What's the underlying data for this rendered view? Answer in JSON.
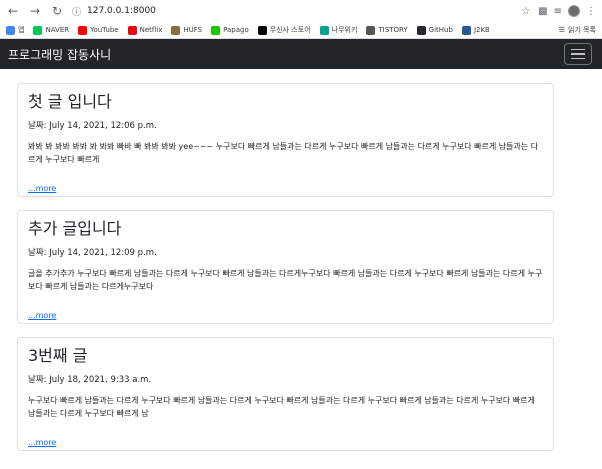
{
  "browser": {
    "url": "127.0.0.1:8000",
    "bookmarks": [
      {
        "label": "앱",
        "color": "#4285f4"
      },
      {
        "label": "NAVER",
        "color": "#03c75a"
      },
      {
        "label": "YouTube",
        "color": "#ff0000"
      },
      {
        "label": "Netflix",
        "color": "#e50914"
      },
      {
        "label": "HUFS",
        "color": "#8a6d3b"
      },
      {
        "label": "Papago",
        "color": "#1ec800"
      },
      {
        "label": "무신사 스토어",
        "color": "#000000"
      },
      {
        "label": "나무위키",
        "color": "#00a495"
      },
      {
        "label": "TISTORY",
        "color": "#555555"
      },
      {
        "label": "GitHub",
        "color": "#24292e"
      },
      {
        "label": "J2KB",
        "color": "#2b5797"
      }
    ],
    "reading_list": "읽기 목록"
  },
  "navbar": {
    "brand": "프로그래밍 잡동사니"
  },
  "posts": [
    {
      "title": "첫 글 입니다",
      "date": "날짜: July 14, 2021, 12:06 p.m.",
      "body": "봐봐 봐 봐봐 봐봐 봐 봐봐 빠바 빠 봐봐 봐봐 yee~~~ 누구보다 빠르게 남들과는 다르게 누구보다 빠르게 남들과는 다르게 누구보다 빠르게 남들과는 다르게 누구보다 빠르게",
      "more": "...more"
    },
    {
      "title": "추가 글입니다",
      "date": "날짜: July 14, 2021, 12:09 p.m.",
      "body": "글을 추가추가 누구보다 빠르게 남들과는 다르게 누구보다 빠르게 남들과는 다르게누구보다 빠르게 남들과는 다르게 누구보다 빠르게 남들과는 다르게 누구보다 빠르게 남들과는 다르게누구보다",
      "more": "...more"
    },
    {
      "title": "3번째 글",
      "date": "날짜: July 18, 2021, 9:33 a.m.",
      "body": "누구보다 빠르게 남들과는 다르게 누구보다 빠르게 남들과는 다르게 누구보다 빠르게 남들과는 다르게 누구보다 빠르게 남들과는 다르게 누구보다 빠르게 남들과는 다르게 누구보다 빠르게 남",
      "more": "...more"
    }
  ]
}
